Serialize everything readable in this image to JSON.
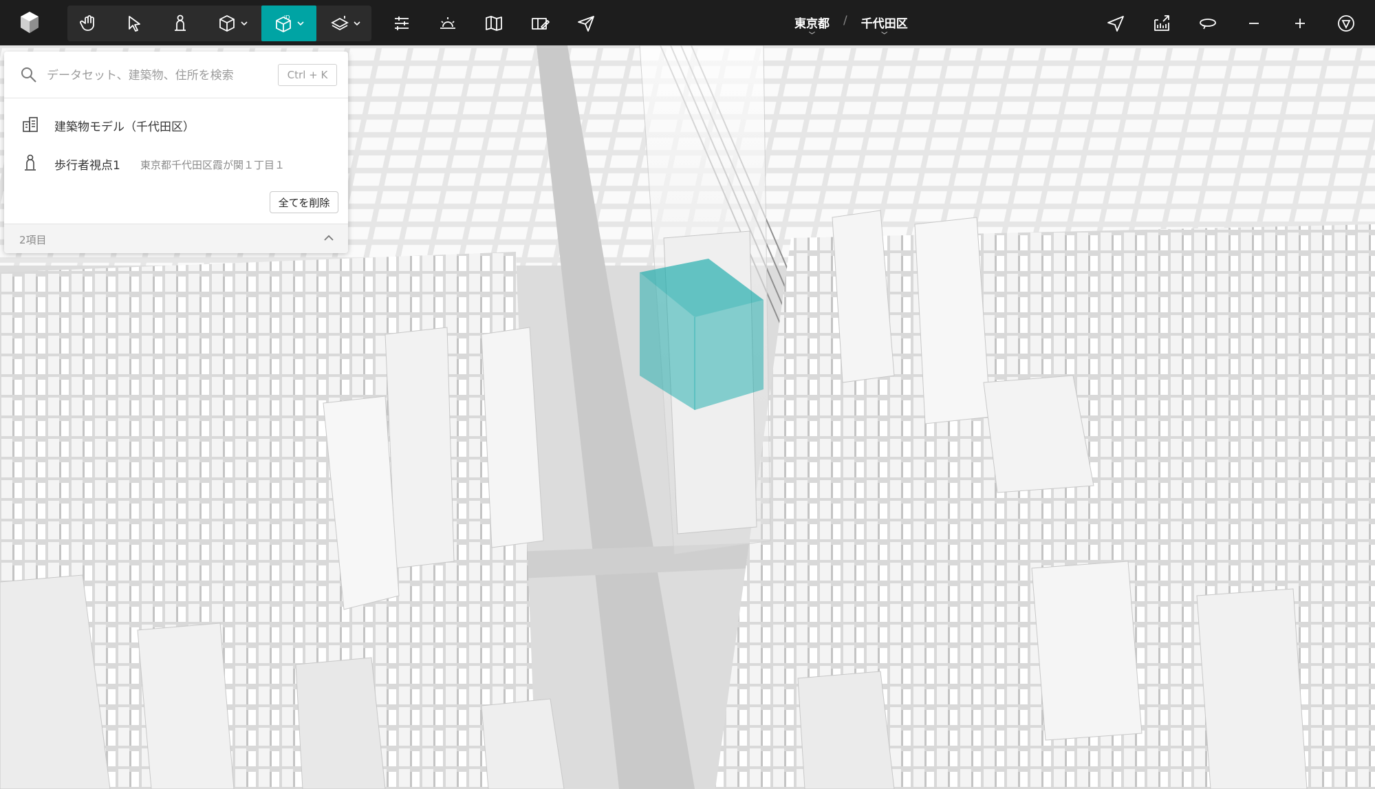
{
  "app": {
    "logo_icon": "app-logo-icon",
    "tools": [
      {
        "name": "pan",
        "icon": "hand-icon"
      },
      {
        "name": "select",
        "icon": "cursor-icon"
      },
      {
        "name": "pedestrian",
        "icon": "person-icon"
      },
      {
        "name": "primitive",
        "icon": "cube-icon",
        "dropdown": true
      },
      {
        "name": "building-id",
        "icon": "3d-building-icon",
        "dropdown": true,
        "active": true
      },
      {
        "name": "layers",
        "icon": "layers-icon",
        "dropdown": true
      },
      {
        "name": "settings",
        "icon": "sliders-icon"
      },
      {
        "name": "sun",
        "icon": "sunrise-icon"
      },
      {
        "name": "map",
        "icon": "map-icon"
      },
      {
        "name": "sketch",
        "icon": "sketch-icon"
      },
      {
        "name": "share",
        "icon": "send-icon"
      }
    ],
    "right_tools": [
      {
        "name": "location",
        "icon": "navigate-icon"
      },
      {
        "name": "export",
        "icon": "export-icon"
      },
      {
        "name": "rotate",
        "icon": "rotate-icon"
      },
      {
        "name": "zoom-out",
        "icon": "minus-icon"
      },
      {
        "name": "zoom-in",
        "icon": "plus-icon"
      },
      {
        "name": "compass",
        "icon": "compass-icon"
      }
    ],
    "accent_color": "#00a4a4"
  },
  "breadcrumb": {
    "prefecture": "東京都",
    "separator": "/",
    "ward": "千代田区"
  },
  "search": {
    "placeholder": "データセット、建築物、住所を検索",
    "shortcut": "Ctrl + K",
    "results": [
      {
        "label": "建築物モデル（千代田区）",
        "sub": "",
        "icon": "building-model-icon"
      },
      {
        "label": "歩行者視点1",
        "sub": "東京都千代田区霞が関１丁目１",
        "icon": "pedestrian-icon"
      }
    ],
    "clear_all": "全てを削除",
    "count": "2項目"
  }
}
